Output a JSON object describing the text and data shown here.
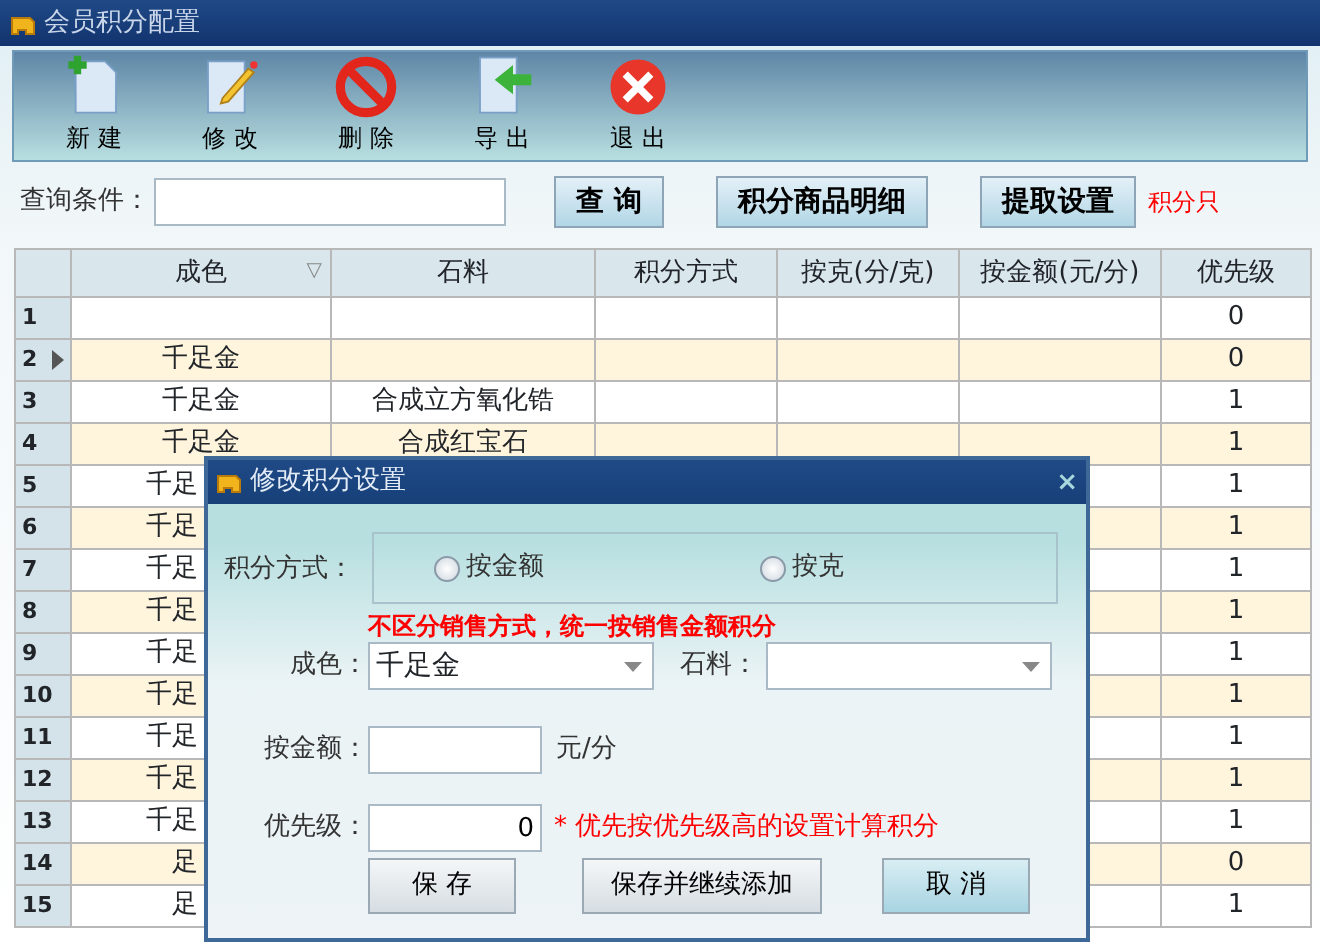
{
  "window": {
    "title": "会员积分配置"
  },
  "toolbar": [
    {
      "label": "新 建",
      "kind": "new"
    },
    {
      "label": "修 改",
      "kind": "edit"
    },
    {
      "label": "删 除",
      "kind": "delete"
    },
    {
      "label": "导 出",
      "kind": "export"
    },
    {
      "label": "退 出",
      "kind": "exit"
    }
  ],
  "search": {
    "label": "查询条件：",
    "buttons": [
      "查 询",
      "积分商品明细",
      "提取设置"
    ],
    "note": "积分只"
  },
  "table": {
    "columns": [
      {
        "label": "成色",
        "sort_mark": "▽"
      },
      {
        "label": "石料"
      },
      {
        "label": "积分方式"
      },
      {
        "label": "按克(分/克)"
      },
      {
        "label": "按金额(元/分)"
      },
      {
        "label": "优先级"
      }
    ],
    "rows": [
      {
        "number": "1",
        "current": false,
        "cells": [
          "",
          "",
          "",
          "",
          "",
          "0"
        ]
      },
      {
        "number": "2",
        "current": true,
        "partial": false,
        "cells": [
          "千足金",
          "",
          "",
          "",
          "",
          "0"
        ]
      },
      {
        "number": "3",
        "current": false,
        "partial": false,
        "cells": [
          "千足金",
          "合成立方氧化锆",
          "",
          "",
          "",
          "1"
        ]
      },
      {
        "number": "4",
        "current": false,
        "partial": false,
        "cells": [
          "千足金",
          "合成红宝石",
          "",
          "",
          "",
          "1"
        ]
      },
      {
        "number": "5",
        "current": false,
        "partial": true,
        "cells": [
          "千足",
          "",
          "",
          "",
          "",
          "1"
        ]
      },
      {
        "number": "6",
        "current": false,
        "partial": true,
        "cells": [
          "千足",
          "",
          "",
          "",
          "",
          "1"
        ]
      },
      {
        "number": "7",
        "current": false,
        "partial": true,
        "cells": [
          "千足",
          "",
          "",
          "",
          "",
          "1"
        ]
      },
      {
        "number": "8",
        "current": false,
        "partial": true,
        "cells": [
          "千足",
          "",
          "",
          "",
          "",
          "1"
        ]
      },
      {
        "number": "9",
        "current": false,
        "partial": true,
        "cells": [
          "千足",
          "",
          "",
          "",
          "",
          "1"
        ]
      },
      {
        "number": "10",
        "current": false,
        "partial": true,
        "cells": [
          "千足",
          "",
          "",
          "",
          "",
          "1"
        ]
      },
      {
        "number": "11",
        "current": false,
        "partial": true,
        "cells": [
          "千足",
          "",
          "",
          "",
          "",
          "1"
        ]
      },
      {
        "number": "12",
        "current": false,
        "partial": true,
        "cells": [
          "千足",
          "",
          "",
          "",
          "",
          "1"
        ]
      },
      {
        "number": "13",
        "current": false,
        "partial": true,
        "cells": [
          "千足",
          "",
          "",
          "",
          "",
          "1"
        ]
      },
      {
        "number": "14",
        "current": false,
        "partial": true,
        "cells": [
          "足",
          "",
          "",
          "",
          "",
          "0"
        ]
      },
      {
        "number": "15",
        "current": false,
        "partial": true,
        "cells": [
          "足",
          "",
          "",
          "",
          "",
          "1"
        ]
      }
    ]
  },
  "dialog": {
    "title": "修改积分设置",
    "close": "×",
    "method_label": "积分方式：",
    "options": [
      {
        "label": "按金额",
        "selected": false
      },
      {
        "label": "按克",
        "selected": false
      }
    ],
    "note": "不区分销售方式，统一按销售金额积分",
    "color_label": "成色：",
    "color_value": "千足金",
    "stone_label": "石料：",
    "amount_label": "按金额：",
    "amount_unit": "元/分",
    "priority_label": "优先级：",
    "priority_value": "0",
    "priority_hint": "* 优先按优先级高的设置计算积分",
    "buttons": [
      {
        "label": "保 存",
        "kind": "plain"
      },
      {
        "label": "保存并继续添加",
        "kind": "plain"
      },
      {
        "label": "取 消",
        "kind": "focus"
      }
    ]
  }
}
